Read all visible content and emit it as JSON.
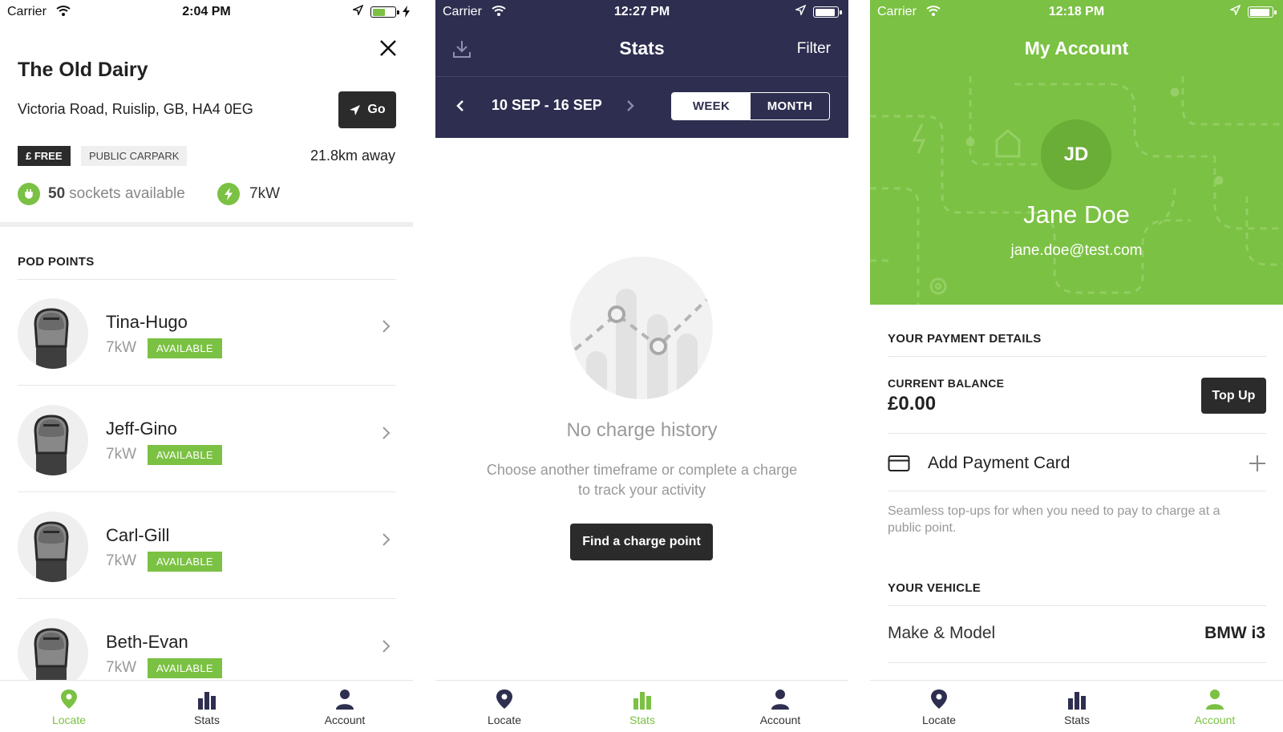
{
  "colors": {
    "brand_green": "#7bc143",
    "header_navy": "#2e2e50",
    "dark_button": "#2b2b2b"
  },
  "screen_locate": {
    "status": {
      "carrier": "Carrier",
      "time": "2:04 PM"
    },
    "site_title": "The Old Dairy",
    "address": "Victoria Road, Ruislip, GB, HA4 0EG",
    "go_label": "Go",
    "tag_free": "£ FREE",
    "tag_carpark": "PUBLIC CARPARK",
    "distance": "21.8km away",
    "sockets_count": "50",
    "sockets_text": "sockets available",
    "power": "7kW",
    "section_title": "POD POINTS",
    "pods": [
      {
        "name": "Tina-Hugo",
        "power": "7kW",
        "status": "AVAILABLE"
      },
      {
        "name": "Jeff-Gino",
        "power": "7kW",
        "status": "AVAILABLE"
      },
      {
        "name": "Carl-Gill",
        "power": "7kW",
        "status": "AVAILABLE"
      },
      {
        "name": "Beth-Evan",
        "power": "7kW",
        "status": "AVAILABLE"
      }
    ]
  },
  "screen_stats": {
    "status": {
      "carrier": "Carrier",
      "time": "12:27 PM"
    },
    "title": "Stats",
    "filter_label": "Filter",
    "date_range": "10 SEP - 16 SEP",
    "segments": {
      "week": "WEEK",
      "month": "MONTH"
    },
    "empty_title": "No charge history",
    "empty_description": "Choose another timeframe or complete a charge to track your activity",
    "find_button": "Find a charge point"
  },
  "screen_account": {
    "status": {
      "carrier": "Carrier",
      "time": "12:18 PM"
    },
    "title": "My Account",
    "initials": "JD",
    "name": "Jane Doe",
    "email": "jane.doe@test.com",
    "payment_section": "YOUR PAYMENT DETAILS",
    "balance_label": "CURRENT BALANCE",
    "balance_value": "£0.00",
    "topup_label": "Top Up",
    "add_card_label": "Add Payment Card",
    "card_note": "Seamless top-ups for when you need to pay to charge at a public point.",
    "vehicle_section": "YOUR VEHICLE",
    "make_model_label": "Make & Model",
    "make_model_value": "BMW i3"
  },
  "tabs": {
    "locate": "Locate",
    "stats": "Stats",
    "account": "Account"
  },
  "icons": {
    "status": [
      "wifi-icon",
      "location-arrow-icon",
      "battery-icon",
      "charging-bolt-icon"
    ],
    "locate": [
      "close-icon",
      "navigate-arrow-icon",
      "plug-icon",
      "bolt-icon",
      "pod-charger-icon",
      "chevron-right-icon"
    ],
    "stats": [
      "download-icon",
      "chevron-left-icon",
      "chevron-right-icon",
      "empty-chart-icon"
    ],
    "account": [
      "credit-card-icon",
      "plus-icon"
    ],
    "tabbar": [
      "map-pin-icon",
      "bar-chart-icon",
      "person-icon"
    ]
  }
}
